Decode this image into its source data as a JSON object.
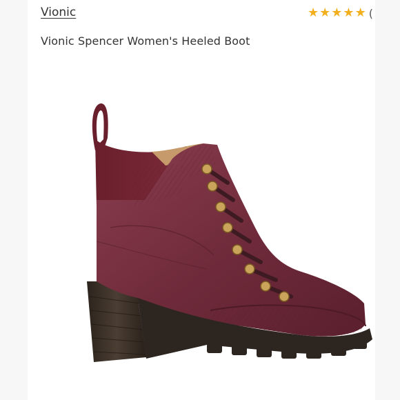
{
  "brand": {
    "label": "Vionic"
  },
  "rating": {
    "stars": 5,
    "count_text": "("
  },
  "product": {
    "title": "Vionic Spencer Women's Heeled Boot",
    "image_icon": "boot-image",
    "color": "#6e2a3a"
  },
  "colors": {
    "star": "#f2b01e",
    "text": "#333333"
  }
}
